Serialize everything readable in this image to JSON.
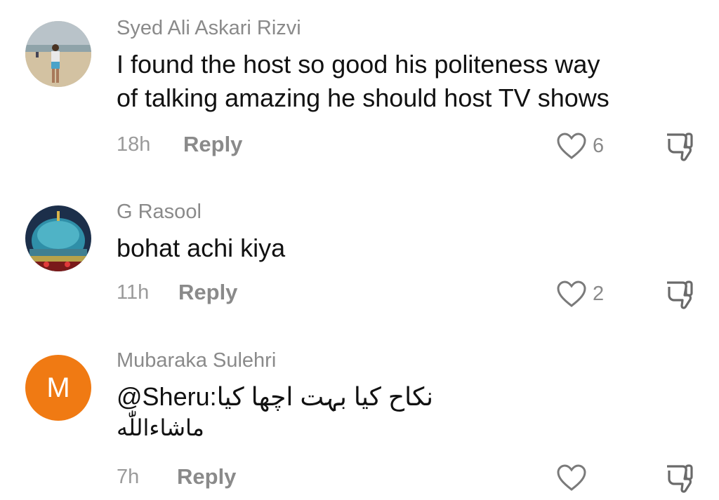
{
  "comments": [
    {
      "author": "Syed Ali Askari Rizvi",
      "lines": [
        "I found the host so good his politeness way",
        "of talking amazing he should host TV shows"
      ],
      "time": "18h",
      "reply_label": "Reply",
      "like_count": "6",
      "avatar_type": "photo-beach"
    },
    {
      "author": "G Rasool",
      "lines": [
        "bohat achi kiya"
      ],
      "time": "11h",
      "reply_label": "Reply",
      "like_count": "2",
      "avatar_type": "photo-dome"
    },
    {
      "author": "Mubaraka Sulehri",
      "lines": [
        "@Sheru:نکاح کیا بہت اچھا کیا",
        "ماشاءاللّٰه"
      ],
      "time": "7h",
      "reply_label": "Reply",
      "like_count": "",
      "avatar_type": "letter",
      "avatar_letter": "M",
      "avatar_color": "#f07a13"
    }
  ]
}
